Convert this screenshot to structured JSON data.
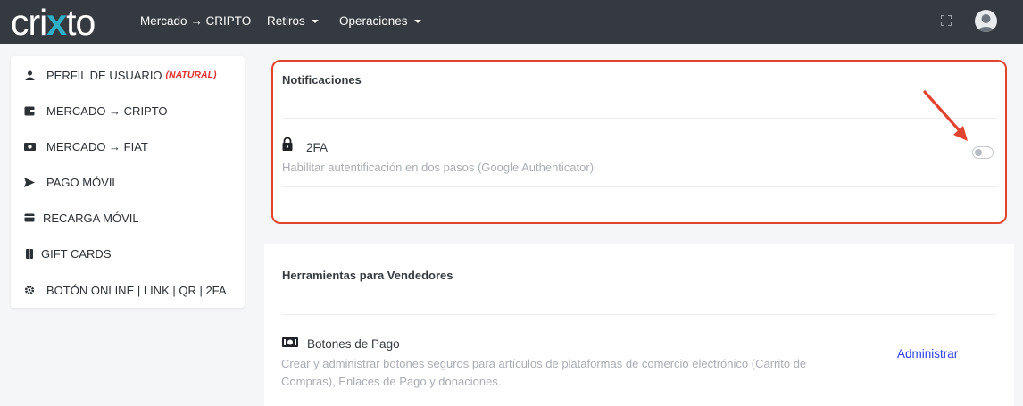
{
  "brand": {
    "logo_part1": "cri",
    "logo_x": "x",
    "logo_part2": "to"
  },
  "nav": {
    "market_cripto": "Mercado → CRIPTO",
    "retiros": "Retiros",
    "operaciones": "Operaciones"
  },
  "sidebar": {
    "items": [
      {
        "label": "PERFIL DE USUARIO",
        "tag": "(NATURAL)",
        "icon": "user-icon"
      },
      {
        "label": "MERCADO → CRIPTO",
        "icon": "wallet-icon"
      },
      {
        "label": "MERCADO → FIAT",
        "icon": "money-icon"
      },
      {
        "label": "PAGO MÓVIL",
        "icon": "send-icon"
      },
      {
        "label": "RECARGA MÓVIL",
        "icon": "card-icon"
      },
      {
        "label": "GIFT CARDS",
        "icon": "giftcard-icon"
      },
      {
        "label": "BOTÓN ONLINE | LINK | QR | 2FA",
        "icon": "gear-icon"
      }
    ]
  },
  "notifications": {
    "title": "Notificaciones",
    "twofa_title": "2FA",
    "twofa_desc": "Habilitar autentificación en dos pasos (Google Authenticator)",
    "twofa_enabled": false
  },
  "sellers": {
    "title": "Herramientas para Vendedores",
    "payment_buttons_title": "Botones de Pago",
    "payment_buttons_desc_line1": "Crear y administrar botones seguros para artículos de plataformas de comercio electrónico (Carrito de",
    "payment_buttons_desc_line2": "Compras), Enlaces de Pago y donaciones.",
    "manage_label": "Administrar"
  },
  "colors": {
    "topbar": "#353a40",
    "logo_accent": "#2fb0c9",
    "highlight_border": "#e0442e",
    "link": "#2c3fe6",
    "tag_red": "#e03131"
  }
}
